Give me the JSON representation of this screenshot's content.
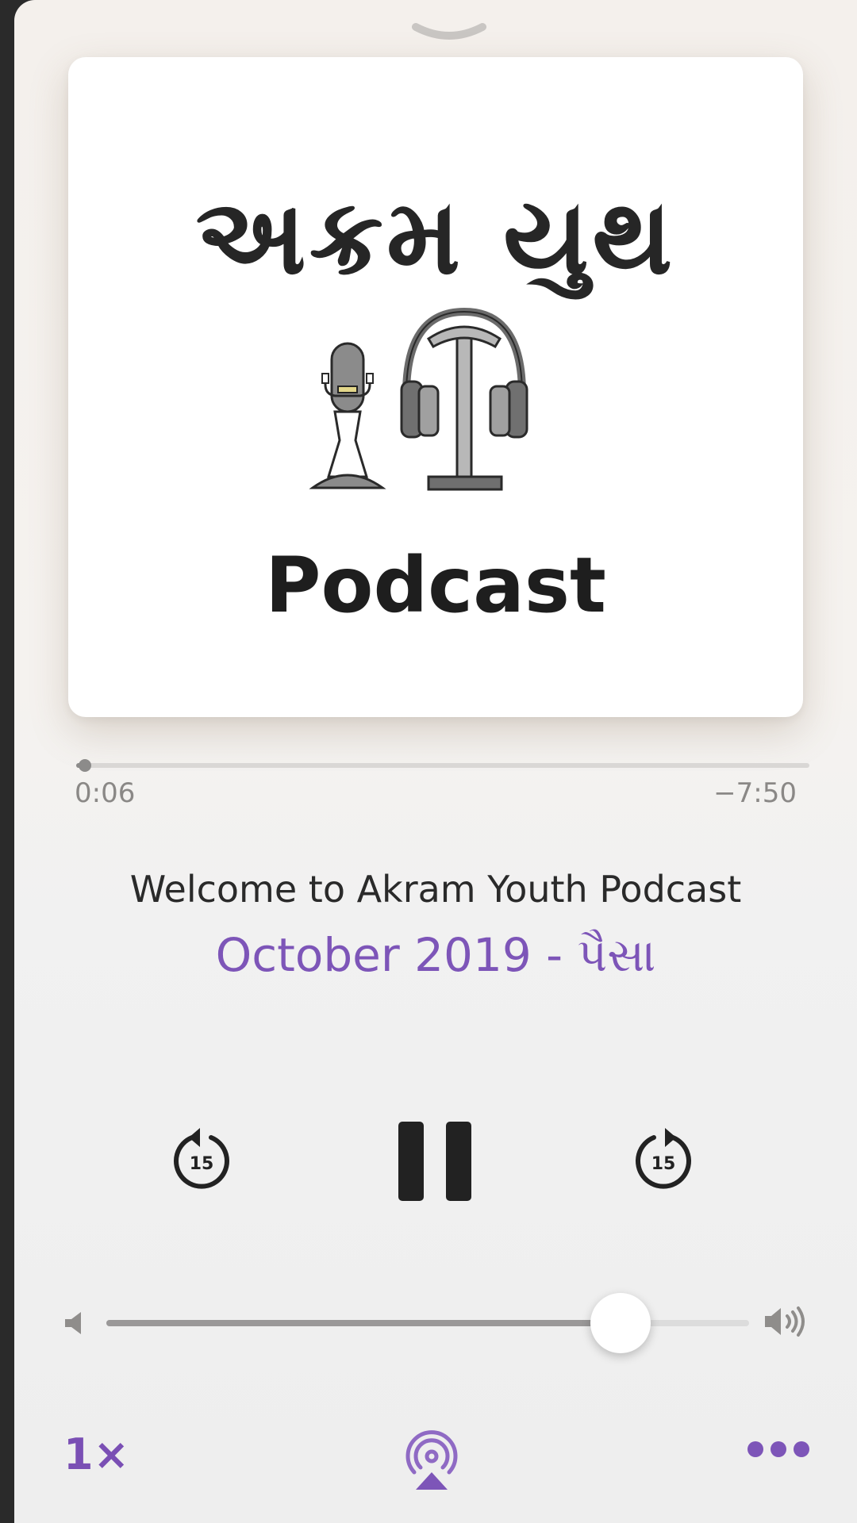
{
  "artwork": {
    "title": "અક્રમ યુથ",
    "label": "Podcast"
  },
  "playback": {
    "elapsed": "0:06",
    "remaining": "−7:50",
    "progress_fraction": 0.012
  },
  "episode": {
    "title": "Welcome to Akram Youth Podcast",
    "subtitle": "October 2019 - પૈસા"
  },
  "controls": {
    "skip_back_seconds": "15",
    "skip_forward_seconds": "15",
    "speed_label": "1×"
  },
  "volume": {
    "level_fraction": 0.8
  },
  "icons": {
    "grabber": "chevron-down-icon",
    "skip_back": "skip-back-15-icon",
    "pause": "pause-icon",
    "skip_forward": "skip-forward-15-icon",
    "volume_low": "speaker-low-icon",
    "volume_high": "speaker-high-icon",
    "airplay": "airplay-audio-icon",
    "more": "more-dots-icon"
  },
  "colors": {
    "accent": "#7d55b8",
    "text_primary": "#2a2a2a",
    "text_secondary": "#8a8886",
    "control": "#222222"
  }
}
